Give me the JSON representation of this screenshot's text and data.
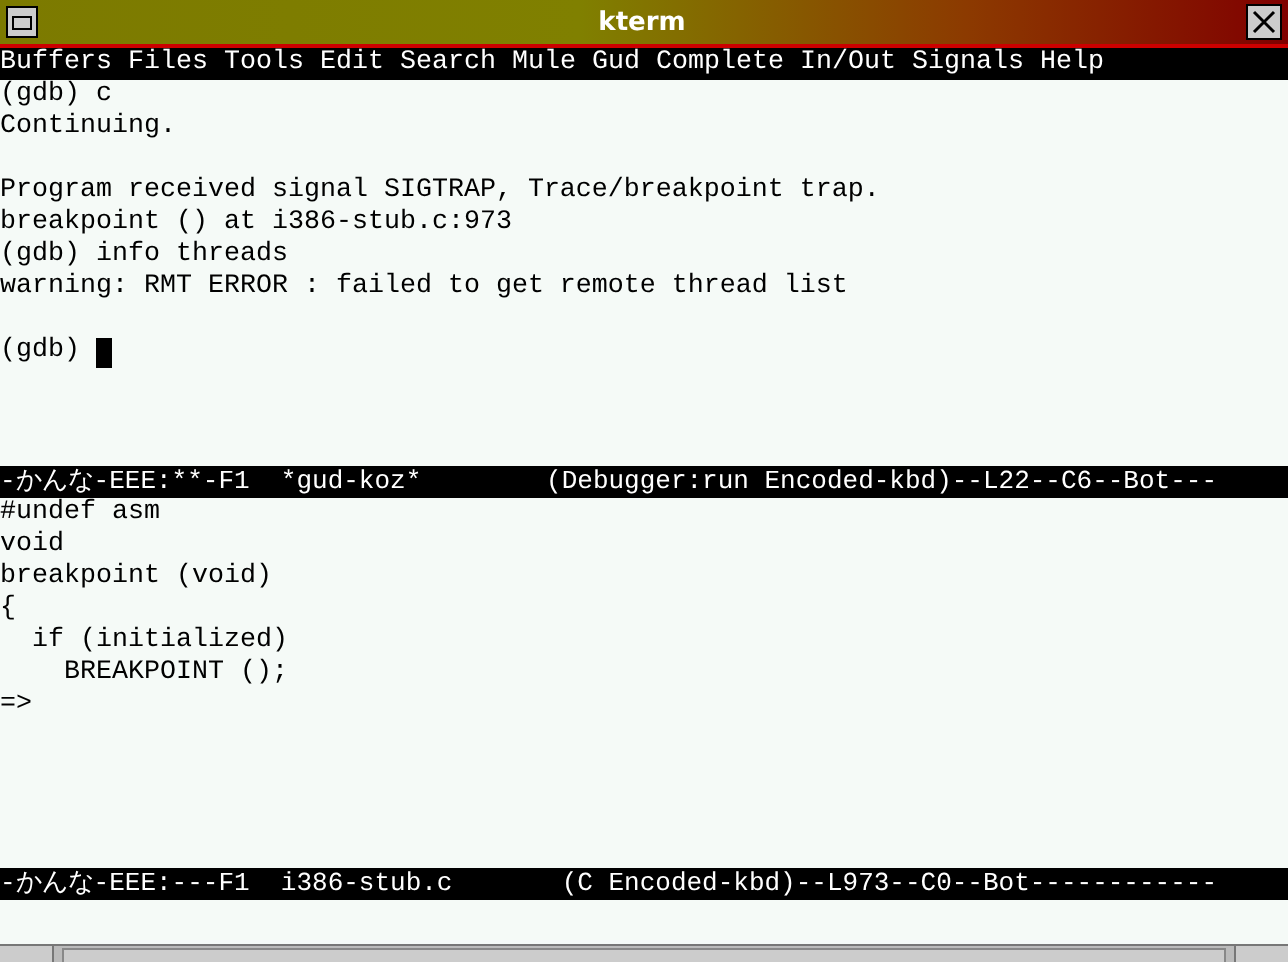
{
  "window": {
    "title": "kterm"
  },
  "menu": [
    "Buffers",
    "Files",
    "Tools",
    "Edit",
    "Search",
    "Mule",
    "Gud",
    "Complete",
    "In/Out",
    "Signals",
    "Help"
  ],
  "gdb_buffer": {
    "blocks": [
      {
        "lines": [
          "(gdb) c",
          "Continuing."
        ],
        "cursor": false
      },
      {
        "lines": [
          "Program received signal SIGTRAP, Trace/breakpoint trap.",
          "breakpoint () at i386-stub.c:973",
          "(gdb) info threads",
          "warning: RMT ERROR : failed to get remote thread list"
        ],
        "cursor": false
      },
      {
        "lines": [
          "(gdb) "
        ],
        "cursor": true
      }
    ],
    "mode_line": "-かんな-EEE:**-F1  *gud-koz*        (Debugger:run Encoded-kbd)--L22--C6--Bot---"
  },
  "source_buffer": {
    "lines": [
      "#undef asm",
      "void",
      "breakpoint (void)",
      "{",
      "  if (initialized)",
      "    BREAKPOINT ();",
      "=>"
    ],
    "mode_line": "-かんな-EEE:---F1  i386-stub.c       (C Encoded-kbd)--L973--C0--Bot------------"
  }
}
